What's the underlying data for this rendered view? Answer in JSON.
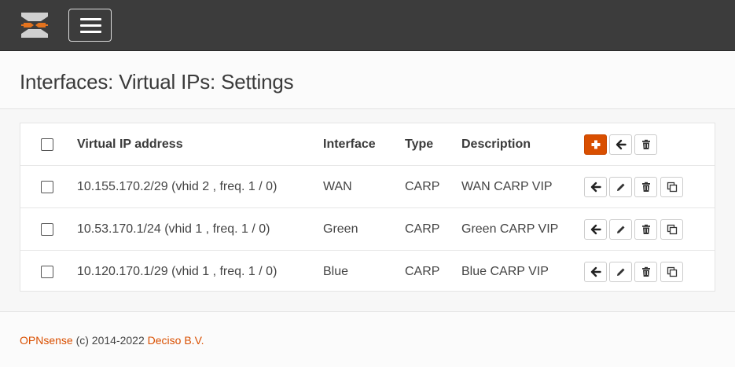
{
  "header": {
    "logo_icon": "opnsense-logo-icon",
    "menu_icon": "hamburger-menu-icon",
    "accent_color": "#d94f00"
  },
  "page": {
    "title": "Interfaces: Virtual IPs: Settings"
  },
  "table": {
    "columns": [
      "Virtual IP address",
      "Interface",
      "Type",
      "Description"
    ],
    "header_actions": [
      "add-icon",
      "apply-icon",
      "delete-icon"
    ],
    "rows": [
      {
        "address": "10.155.170.2/29 (vhid 2 , freq. 1 / 0)",
        "interface": "WAN",
        "type": "CARP",
        "description": "WAN CARP VIP"
      },
      {
        "address": "10.53.170.1/24 (vhid 1 , freq. 1 / 0)",
        "interface": "Green",
        "type": "CARP",
        "description": "Green CARP VIP"
      },
      {
        "address": "10.120.170.1/29 (vhid 1 , freq. 1 / 0)",
        "interface": "Blue",
        "type": "CARP",
        "description": "Blue CARP VIP"
      }
    ],
    "row_actions": [
      "apply-icon",
      "edit-icon",
      "delete-icon",
      "copy-icon"
    ]
  },
  "footer": {
    "brand": "OPNsense",
    "copyright": " (c) 2014-2022 ",
    "company": "Deciso B.V."
  }
}
